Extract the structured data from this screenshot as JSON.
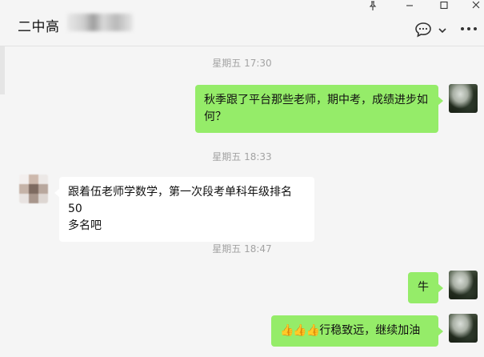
{
  "header": {
    "chat_title": "二中高",
    "window_buttons": [
      "pin-icon",
      "minimize-icon",
      "maximize-icon",
      "close-icon"
    ],
    "toolbar_icons": [
      "chat-bubble-icon",
      "chevron-down-icon",
      "more-icon"
    ]
  },
  "messages": [
    {
      "type": "timestamp",
      "text": "星期五 17:30"
    },
    {
      "type": "sent",
      "text_line1": "秋季跟了平台那些老师，期中考，成绩进步如",
      "text_line2": "何？"
    },
    {
      "type": "timestamp",
      "text": "星期五 18:33"
    },
    {
      "type": "received",
      "text_line1": "跟着伍老师学数学，第一次段考单科年级排名50",
      "text_line2": "多名吧"
    },
    {
      "type": "timestamp",
      "text": "星期五 18:47"
    },
    {
      "type": "sent",
      "text": "牛"
    },
    {
      "type": "sent",
      "emoji": "👍👍👍",
      "text": "行稳致远，继续加油"
    }
  ],
  "colors": {
    "sent_bubble": "#95ec69",
    "received_bubble": "#ffffff",
    "background": "#f5f5f5",
    "timestamp": "#a3a3a3"
  }
}
